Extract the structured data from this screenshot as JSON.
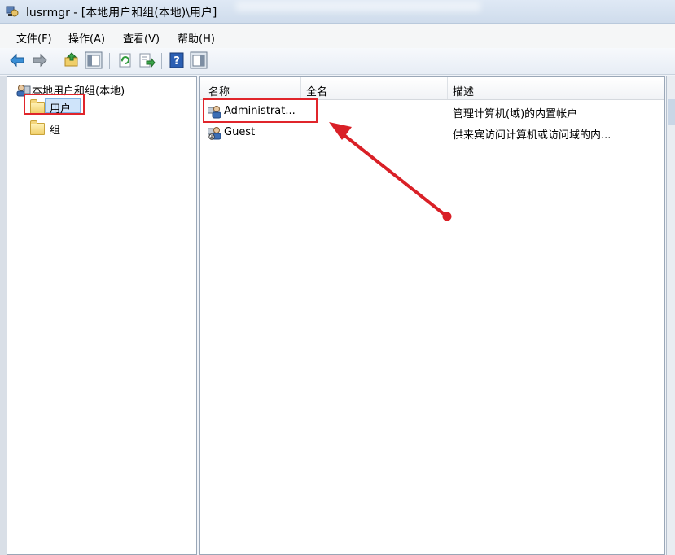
{
  "window": {
    "title": "lusrmgr - [本地用户和组(本地)\\用户]"
  },
  "menu": {
    "items": [
      "文件(F)",
      "操作(A)",
      "查看(V)",
      "帮助(H)"
    ]
  },
  "toolbar": {
    "icons": [
      "back-arrow-icon",
      "forward-arrow-icon",
      "up-folder-icon",
      "show-hide-tree-icon",
      "refresh-icon",
      "export-list-icon",
      "help-icon",
      "show-hide-action-pane-icon"
    ]
  },
  "tree": {
    "root_label": "本地用户和组(本地)",
    "children": [
      {
        "label": "用户",
        "selected": true
      },
      {
        "label": "组",
        "selected": false
      }
    ]
  },
  "list": {
    "columns": [
      "名称",
      "全名",
      "描述"
    ],
    "rows": [
      {
        "name": "Administrat...",
        "fullname": "",
        "description": "管理计算机(域)的内置帐户"
      },
      {
        "name": "Guest",
        "fullname": "",
        "description": "供来宾访问计算机或访问域的内..."
      }
    ]
  },
  "colors": {
    "highlight_red": "#e0252b",
    "selection_blue": "#cfe4fa"
  }
}
